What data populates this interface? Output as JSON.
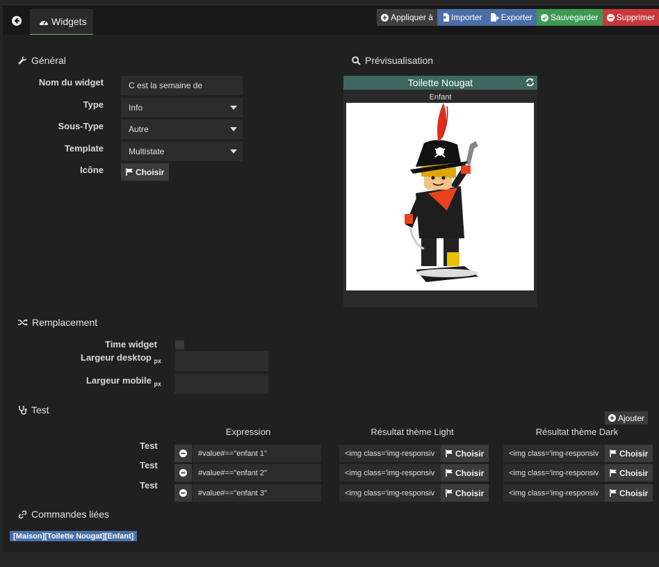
{
  "toolbar": {
    "tab_label": "Widgets",
    "apply_label": "Appliquer à",
    "import_label": "Importer",
    "export_label": "Exporter",
    "save_label": "Sauvegarder",
    "delete_label": "Supprimer",
    "colors": {
      "blue": "#4a6ea8",
      "green": "#3c9a52",
      "red": "#c8393b",
      "tab_underline": "#7ab55c"
    }
  },
  "general": {
    "title": "Général",
    "name_label": "Nom du widget",
    "name_value": "C est la semaine de",
    "type_label": "Type",
    "type_value": "Info",
    "subtype_label": "Sous-Type",
    "subtype_value": "Autre",
    "template_label": "Template",
    "template_value": "Multistate",
    "icon_label": "Icône",
    "choose_label": "Choisir"
  },
  "preview": {
    "title": "Prévisualisation",
    "widget_name": "Toilette Nougat",
    "state_label": "Enfant",
    "header_color": "#3e6660"
  },
  "replacement": {
    "title": "Remplacement",
    "time_widget_label": "Time widget",
    "desktop_width_label": "Largeur desktop",
    "mobile_width_label": "Largeur mobile",
    "unit": "px"
  },
  "test": {
    "title": "Test",
    "add_label": "Ajouter",
    "col_expression": "Expression",
    "col_light": "Résultat thème Light",
    "col_dark": "Résultat thème Dark",
    "rows": [
      {
        "label": "Test",
        "expression": "#value#==\"enfant 1\"",
        "light": "<img class='img-responsiv",
        "dark": "<img class='img-responsiv",
        "choose": "Choisir"
      },
      {
        "label": "Test",
        "expression": "#value#==\"enfant 2\"",
        "light": "<img class='img-responsiv",
        "dark": "<img class='img-responsiv",
        "choose": "Choisir"
      },
      {
        "label": "Test",
        "expression": "#value#==\"enfant 3\"",
        "light": "<img class='img-responsiv",
        "dark": "<img class='img-responsiv",
        "choose": "Choisir"
      }
    ]
  },
  "linked": {
    "title": "Commandes liées",
    "command": "[Maison][Toilette Nougat][Enfant]"
  }
}
